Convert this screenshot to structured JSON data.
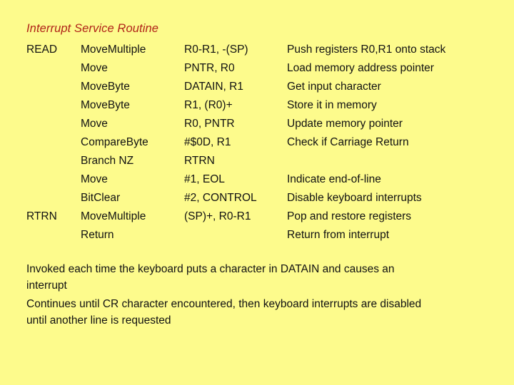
{
  "slide": {
    "background_color": "#FDFB8C",
    "title": "Interrupt Service Routine",
    "title_color": "#B02318",
    "text_color": "#111111"
  },
  "listing": {
    "rows": [
      {
        "label": "READ",
        "instruction": "MoveMultiple",
        "operand": "R0-R1,  -(SP)",
        "comment": "Push registers R0,R1 onto stack"
      },
      {
        "label": "",
        "instruction": "Move",
        "operand": "PNTR, R0",
        "comment": "Load memory address pointer"
      },
      {
        "label": "",
        "instruction": "MoveByte",
        "operand": "DATAIN, R1",
        "comment": "Get input character"
      },
      {
        "label": "",
        "instruction": "MoveByte",
        "operand": "R1, (R0)+",
        "comment": "Store it in memory"
      },
      {
        "label": "",
        "instruction": "Move",
        "operand": "R0, PNTR",
        "comment": "Update memory pointer"
      },
      {
        "label": "",
        "instruction": "CompareByte",
        "operand": "#$0D, R1",
        "comment": "Check if Carriage Return"
      },
      {
        "label": "",
        "instruction": "Branch NZ",
        "operand": "RTRN",
        "comment": ""
      },
      {
        "label": "",
        "instruction": "Move",
        "operand": "#1, EOL",
        "comment": "Indicate end-of-line"
      },
      {
        "label": "",
        "instruction": "BitClear",
        "operand": "#2, CONTROL",
        "comment": "Disable keyboard interrupts"
      },
      {
        "label": "RTRN",
        "instruction": "MoveMultiple",
        "operand": "(SP)+, R0-R1",
        "comment": "Pop and restore registers"
      },
      {
        "label": "",
        "instruction": "Return",
        "operand": "",
        "comment": "Return from interrupt"
      }
    ]
  },
  "notes": [
    {
      "lines": [
        "Invoked each time the keyboard puts a character in DATAIN and causes an",
        "interrupt"
      ]
    },
    {
      "lines": [
        "Continues until CR character encountered, then keyboard interrupts are disabled",
        "until another line is requested"
      ]
    }
  ]
}
